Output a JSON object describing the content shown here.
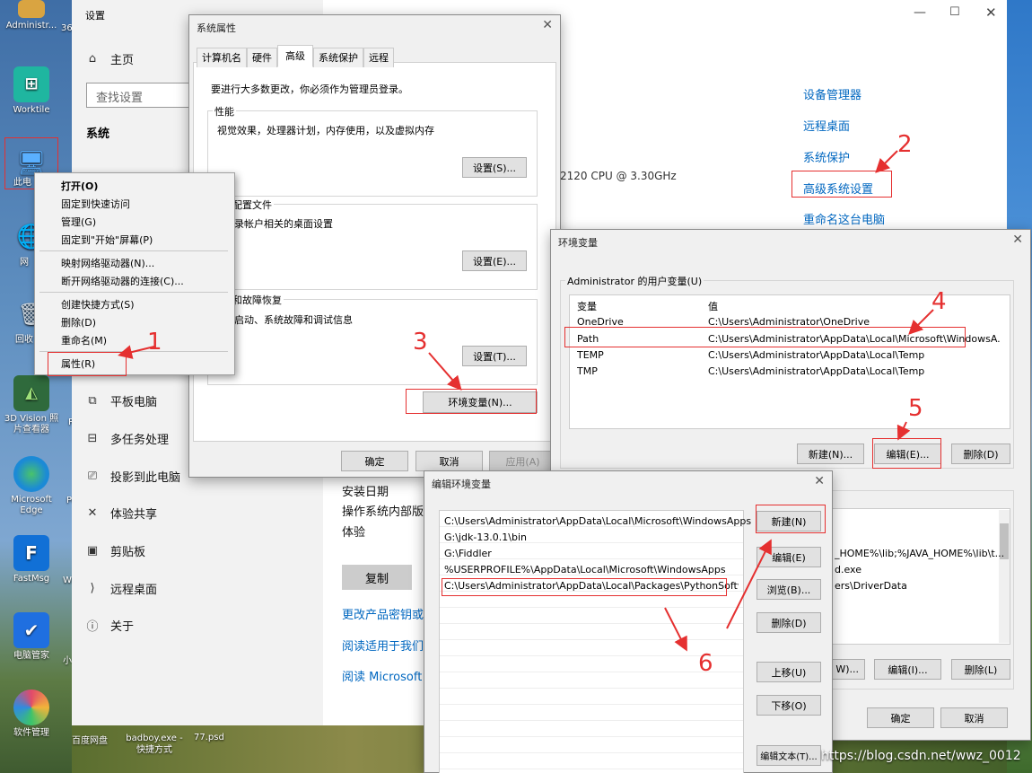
{
  "desktop": {
    "icons": [
      {
        "label": "Administr...",
        "color": "#d9a441"
      },
      {
        "label": "36",
        "color": "#d9a441"
      },
      {
        "label": "Worktile",
        "color": "#1fb6a0"
      },
      {
        "label": "此电",
        "color": "#3b8ede"
      },
      {
        "label": "网",
        "color": "#3b8ede"
      },
      {
        "label": "回收",
        "color": "#9aa7b2"
      },
      {
        "label": "3D Vision 照片查看器",
        "color": "#2f6a3c"
      },
      {
        "label": "Microsoft Edge",
        "color": "#1b8ad6"
      },
      {
        "label": "FastMsg",
        "color": "#1170d6"
      },
      {
        "label": "电脑管家",
        "color": "#1f6fe0"
      },
      {
        "label": "软件管理",
        "color": "#e24a6a"
      }
    ],
    "partial_labels": [
      "P",
      "Po",
      "Wi",
      "小"
    ],
    "bottom_labels": [
      "百度网盘",
      "badboy.exe - 快捷方式",
      "77.psd"
    ],
    "watermark": "https://blog.csdn.net/wwz_0012"
  },
  "settings": {
    "title": "设置",
    "home": "主页",
    "search_placeholder": "查找设置",
    "section": "系统",
    "nav": [
      {
        "label": "平板电脑",
        "icon": "⧉"
      },
      {
        "label": "多任务处理",
        "icon": "⊟"
      },
      {
        "label": "投影到此电脑",
        "icon": "⎚"
      },
      {
        "label": "体验共享",
        "icon": "✕"
      },
      {
        "label": "剪贴板",
        "icon": "▣"
      },
      {
        "label": "远程桌面",
        "icon": "⟩"
      },
      {
        "label": "关于",
        "icon": "ⓘ"
      }
    ],
    "related_links": [
      "设备管理器",
      "远程桌面",
      "系统保护",
      "高级系统设置",
      "重命名这台电脑"
    ],
    "cpu_text": "2120 CPU @ 3.30GHz",
    "about_labels": [
      "安装日期",
      "操作系统内部版",
      "体验"
    ],
    "copy_button": "复制",
    "about_links": [
      "更改产品密钥或",
      "阅读适用于我们",
      "阅读 Microsoft"
    ]
  },
  "context_menu": {
    "items": [
      "打开(O)",
      "固定到快速访问",
      "管理(G)",
      "固定到\"开始\"屏幕(P)",
      "映射网络驱动器(N)...",
      "断开网络驱动器的连接(C)...",
      "创建快捷方式(S)",
      "删除(D)",
      "重命名(M)",
      "属性(R)"
    ]
  },
  "sysprops": {
    "title": "系统属性",
    "tabs": [
      "计算机名",
      "硬件",
      "高级",
      "系统保护",
      "远程"
    ],
    "admin_note": "要进行大多数更改，你必须作为管理员登录。",
    "perf_label": "性能",
    "perf_desc": "视觉效果，处理器计划，内存使用，以及虚拟内存",
    "profile_label": "配置文件",
    "profile_desc": "录帐户相关的桌面设置",
    "startup_label": "和故障恢复",
    "startup_desc": "启动、系统故障和调试信息",
    "settings_btn1": "设置(S)...",
    "settings_btn2": "设置(E)...",
    "settings_btn3": "设置(T)...",
    "env_button": "环境变量(N)...",
    "ok": "确定",
    "cancel": "取消",
    "apply": "应用(A)"
  },
  "envvars": {
    "title": "环境变量",
    "user_group": "Administrator 的用户变量(U)",
    "col_var": "变量",
    "col_val": "值",
    "user_rows": [
      {
        "name": "OneDrive",
        "value": "C:\\Users\\Administrator\\OneDrive"
      },
      {
        "name": "Path",
        "value": "C:\\Users\\Administrator\\AppData\\Local\\Microsoft\\WindowsA..."
      },
      {
        "name": "TEMP",
        "value": "C:\\Users\\Administrator\\AppData\\Local\\Temp"
      },
      {
        "name": "TMP",
        "value": "C:\\Users\\Administrator\\AppData\\Local\\Temp"
      }
    ],
    "new": "新建(N)...",
    "edit": "编辑(E)...",
    "delete": "删除(D)",
    "sys_rows": [
      "_HOME%\\lib;%JAVA_HOME%\\lib\\t...",
      "d.exe",
      "ers\\DriverData"
    ],
    "sys_new": "W)...",
    "sys_edit": "编辑(I)...",
    "sys_delete": "删除(L)",
    "ok": "确定",
    "cancel": "取消"
  },
  "editenv": {
    "title": "编辑环境变量",
    "entries": [
      "C:\\Users\\Administrator\\AppData\\Local\\Microsoft\\WindowsApps",
      "G:\\jdk-13.0.1\\bin",
      "G:\\Fiddler",
      "%USERPROFILE%\\AppData\\Local\\Microsoft\\WindowsApps",
      "C:\\Users\\Administrator\\AppData\\Local\\Packages\\PythonSoftwa..."
    ],
    "buttons": [
      "新建(N)",
      "编辑(E)",
      "浏览(B)...",
      "删除(D)",
      "上移(U)",
      "下移(O)",
      "编辑文本(T)..."
    ]
  },
  "annotations": [
    "1",
    "2",
    "3",
    "4",
    "5",
    "6"
  ],
  "colors": {
    "annotation": "#e53030",
    "link": "#0067c0"
  }
}
